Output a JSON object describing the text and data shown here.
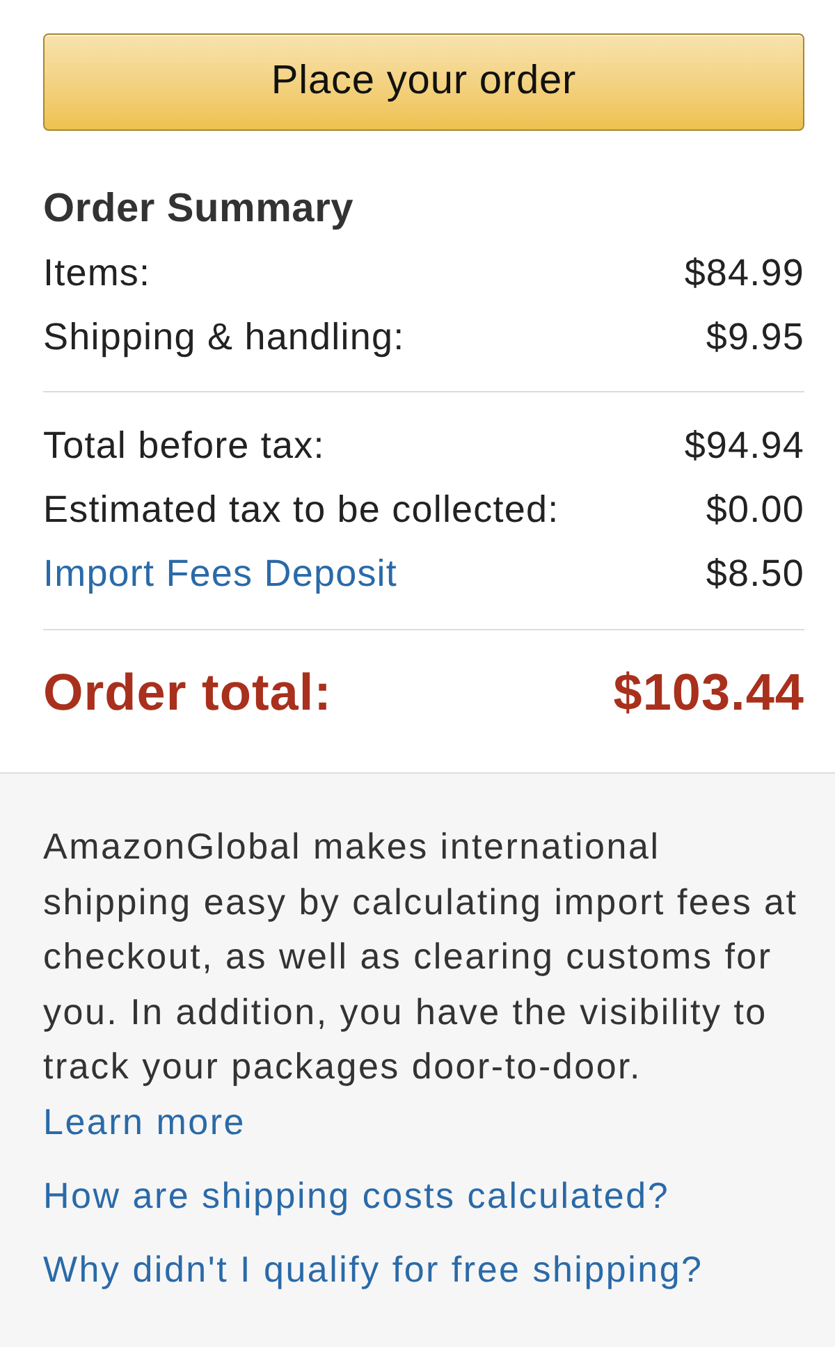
{
  "place_order_button": {
    "label": "Place your order"
  },
  "order_summary": {
    "title": "Order Summary",
    "sections": [
      {
        "lines": [
          {
            "kind": "plain",
            "label": "Items:",
            "amount": "$84.99"
          },
          {
            "kind": "plain",
            "label": "Shipping & handling:",
            "amount": "$9.95"
          }
        ]
      },
      {
        "lines": [
          {
            "kind": "plain",
            "label": "Total before tax:",
            "amount": "$94.94"
          },
          {
            "kind": "plain",
            "label": "Estimated tax to be collected:",
            "amount": "$0.00"
          },
          {
            "kind": "link",
            "label": "Import Fees Deposit",
            "amount": "$8.50"
          }
        ]
      }
    ],
    "total": {
      "label": "Order total:",
      "amount": "$103.44"
    }
  },
  "info_panel": {
    "text": "AmazonGlobal makes international shipping easy by calculating import fees at checkout, as well as clearing customs for you. In addition, you have the visibility to track your packages door-to-door.",
    "link": "Learn more",
    "help_links": [
      "How are shipping costs calculated?",
      "Why didn't I qualify for free shipping?"
    ]
  }
}
